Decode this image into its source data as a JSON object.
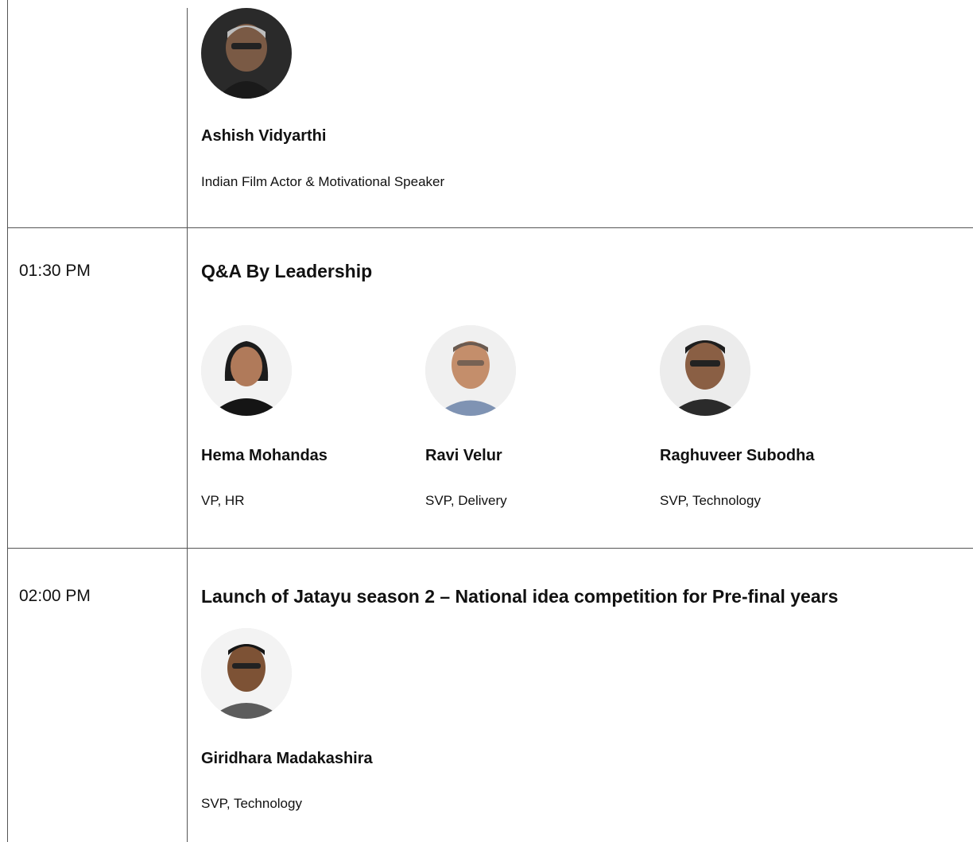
{
  "rows": [
    {
      "time": "",
      "title": "",
      "speakers": [
        {
          "name": "Ashish Vidyarthi",
          "role": "Indian Film Actor & Motivational Speaker",
          "photo": "speaker-photo"
        }
      ]
    },
    {
      "time": "01:30 PM",
      "title": "Q&A By Leadership",
      "speakers": [
        {
          "name": "Hema Mohandas",
          "role": "VP, HR",
          "photo": "speaker-photo"
        },
        {
          "name": "Ravi Velur",
          "role": "SVP,  Delivery",
          "photo": "speaker-photo"
        },
        {
          "name": "Raghuveer Subodha",
          "role": "SVP, Technology",
          "photo": "speaker-photo"
        }
      ]
    },
    {
      "time": "02:00 PM",
      "title": "Launch of Jatayu season 2 – National idea competition for Pre-final years",
      "speakers": [
        {
          "name": "Giridhara Madakashira",
          "role": "SVP, Technology",
          "photo": "speaker-photo"
        }
      ]
    }
  ],
  "colors": {
    "grid_line": "#555555",
    "text": "#111111",
    "background": "#ffffff"
  }
}
